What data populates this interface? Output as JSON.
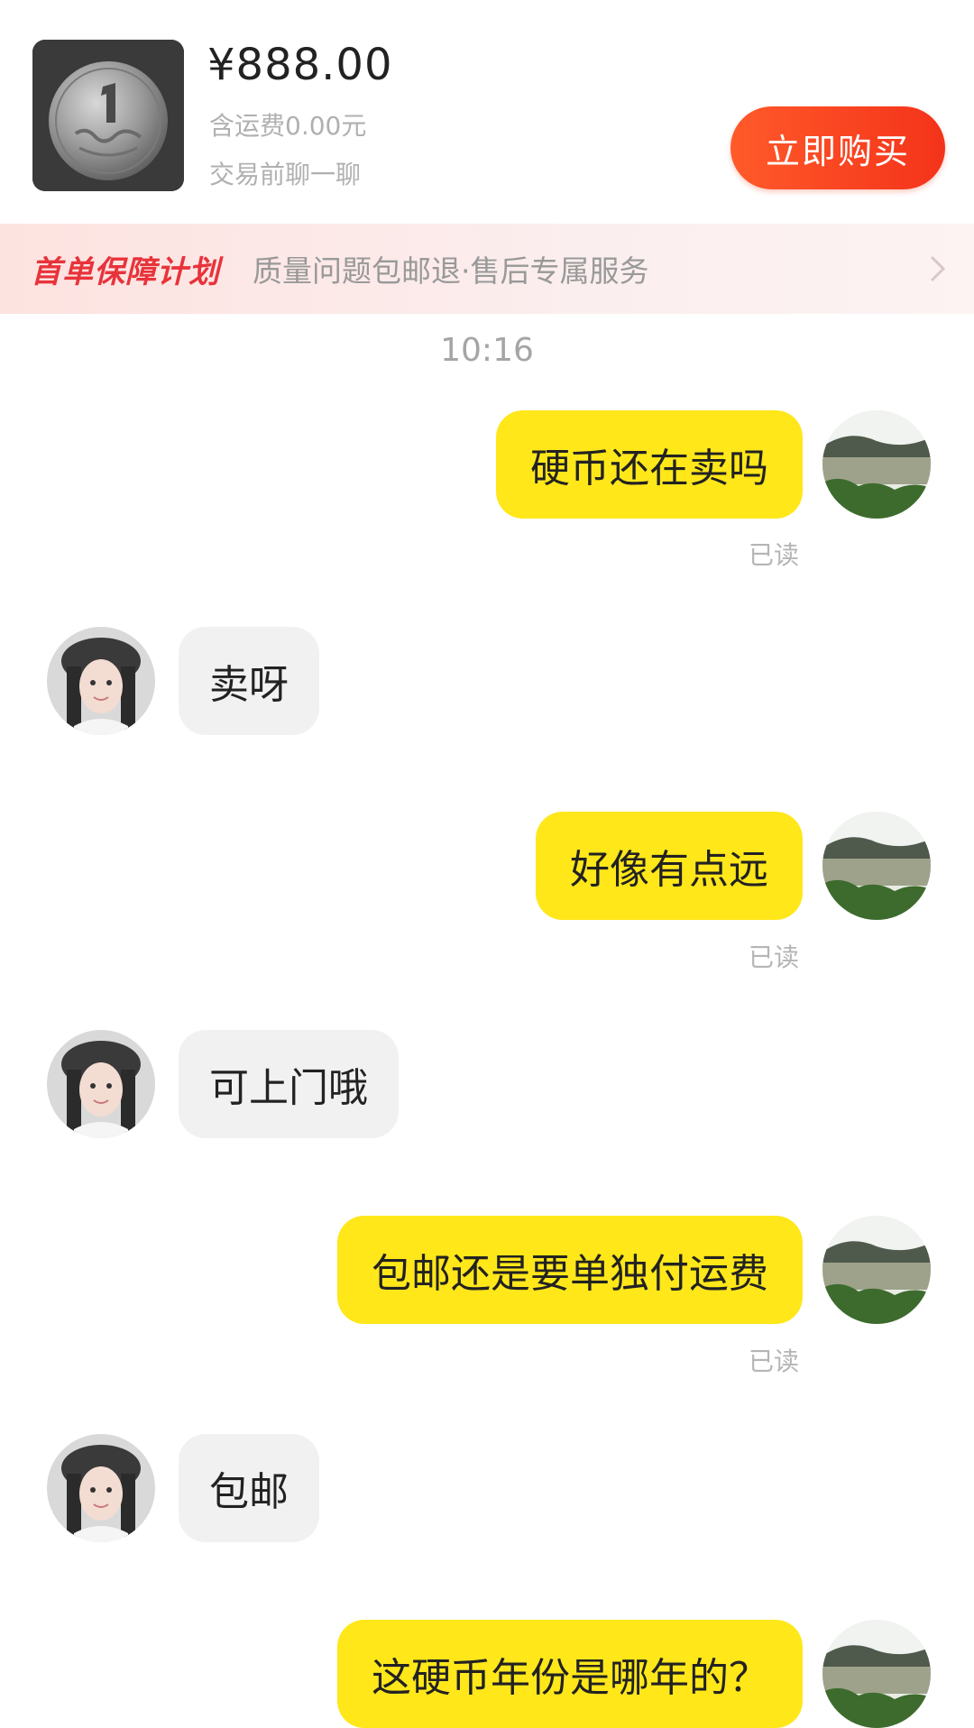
{
  "product": {
    "price": "¥888.00",
    "shipping": "含运费0.00元",
    "chat_hint": "交易前聊一聊",
    "buy_label": "立即购买",
    "accent_color": "#f4331a"
  },
  "guarantee": {
    "title": "首单保障计划",
    "description": "质量问题包邮退·售后专属服务",
    "title_color": "#e8333b"
  },
  "chat": {
    "timestamp": "10:16",
    "my_bubble_color": "#ffe71a",
    "their_bubble_color": "#f1f1f1",
    "messages": [
      {
        "from": "me",
        "text": "硬币还在卖吗",
        "status": "已读"
      },
      {
        "from": "seller",
        "text": "卖呀"
      },
      {
        "from": "me",
        "text": "好像有点远",
        "status": "已读"
      },
      {
        "from": "seller",
        "text": "可上门哦"
      },
      {
        "from": "me",
        "text": "包邮还是要单独付运费",
        "status": "已读"
      },
      {
        "from": "seller",
        "text": "包邮"
      },
      {
        "from": "me",
        "text": "这硬币年份是哪年的？"
      }
    ]
  }
}
